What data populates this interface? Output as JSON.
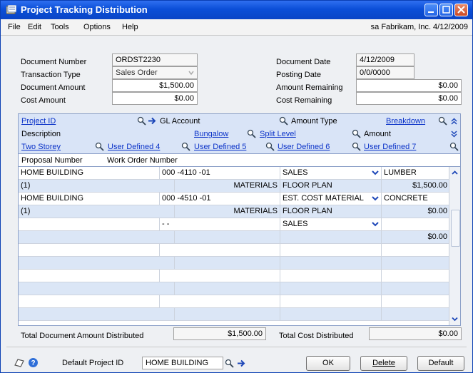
{
  "window": {
    "title": "Project Tracking Distribution"
  },
  "menu": {
    "items": [
      "File",
      "Edit",
      "Tools",
      "Options",
      "Help"
    ],
    "status": "sa  Fabrikam, Inc.  4/12/2009"
  },
  "header": {
    "document_number_label": "Document Number",
    "document_number": "ORDST2230",
    "transaction_type_label": "Transaction Type",
    "transaction_type": "Sales Order",
    "document_amount_label": "Document  Amount",
    "document_amount": "$1,500.00",
    "cost_amount_label": "Cost Amount",
    "cost_amount": "$0.00",
    "document_date_label": "Document Date",
    "document_date": "4/12/2009",
    "posting_date_label": "Posting Date",
    "posting_date": "0/0/0000",
    "amount_remaining_label": "Amount Remaining",
    "amount_remaining": "$0.00",
    "cost_remaining_label": "Cost Remaining",
    "cost_remaining": "$0.00"
  },
  "grid_header": {
    "project_id": "Project ID",
    "gl_account": "GL Account",
    "amount_type": "Amount Type",
    "breakdown": "Breakdown",
    "description": "Description",
    "bungalow": "Bungalow",
    "split_level": "Split Level",
    "amount": "Amount",
    "two_storey": "Two Storey",
    "user_defined_4": "User Defined 4",
    "user_defined_5": "User Defined 5",
    "user_defined_6": "User Defined 6",
    "user_defined_7": "User Defined 7",
    "proposal_number": "Proposal Number",
    "work_order_number": "Work Order Number"
  },
  "grid_rows": [
    {
      "c1": "HOME BUILDING",
      "c2": "000 -4110 -01",
      "c3": "",
      "c4": "SALES",
      "c5": "LUMBER",
      "dd": true
    },
    {
      "c1": "(1)",
      "c2": "",
      "c3": "MATERIALS",
      "c4": "FLOOR PLAN",
      "c5": "$1,500.00",
      "dd": false
    },
    {
      "c1": "HOME BUILDING",
      "c2": "000 -4510 -01",
      "c3": "",
      "c4": "EST. COST MATERIAL",
      "c5": "CONCRETE",
      "dd": true
    },
    {
      "c1": "(1)",
      "c2": "",
      "c3": "MATERIALS",
      "c4": "FLOOR PLAN",
      "c5": "$0.00",
      "dd": false
    },
    {
      "c1": "",
      "c2": "-          -",
      "c3": "",
      "c4": "SALES",
      "c5": "",
      "dd": true
    },
    {
      "c1": "",
      "c2": "",
      "c3": "",
      "c4": "",
      "c5": "$0.00",
      "dd": false
    },
    {
      "c1": "",
      "c2": "",
      "c3": "",
      "c4": "",
      "c5": "",
      "dd": false
    },
    {
      "c1": "",
      "c2": "",
      "c3": "",
      "c4": "",
      "c5": "",
      "dd": false
    },
    {
      "c1": "",
      "c2": "",
      "c3": "",
      "c4": "",
      "c5": "",
      "dd": false
    },
    {
      "c1": "",
      "c2": "",
      "c3": "",
      "c4": "",
      "c5": "",
      "dd": false
    },
    {
      "c1": "",
      "c2": "",
      "c3": "",
      "c4": "",
      "c5": "",
      "dd": false
    },
    {
      "c1": "",
      "c2": "",
      "c3": "",
      "c4": "",
      "c5": "",
      "dd": false
    }
  ],
  "totals": {
    "doc_label": "Total Document Amount Distributed",
    "doc_value": "$1,500.00",
    "cost_label": "Total Cost Distributed",
    "cost_value": "$0.00"
  },
  "footer": {
    "default_project_label": "Default Project ID",
    "default_project_value": "HOME BUILDING",
    "ok": "OK",
    "delete": "Delete",
    "default": "Default"
  },
  "colors": {
    "title_bar": "#0b4fd8",
    "grid_alt_row": "#dbe6f6",
    "link": "#0a32c8"
  }
}
